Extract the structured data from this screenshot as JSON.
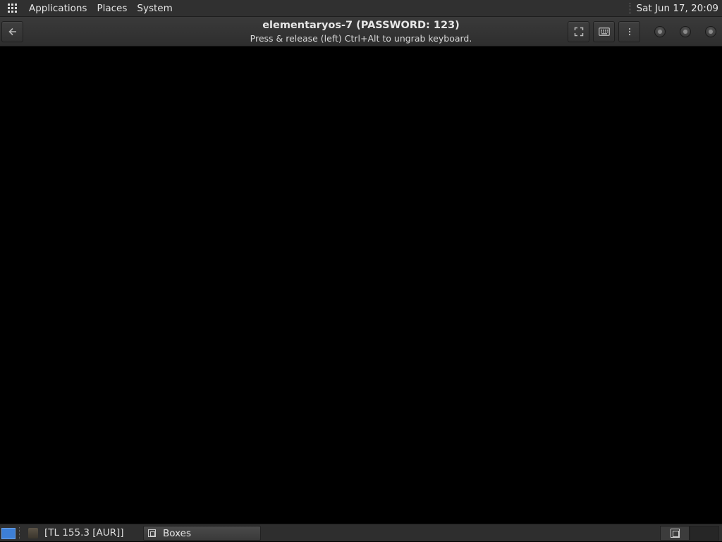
{
  "top_panel": {
    "menus": [
      "Applications",
      "Places",
      "System"
    ],
    "clock": "Sat Jun 17, 20:09"
  },
  "window": {
    "title": "elementaryos-7 (PASSWORD: 123)",
    "subtitle": "Press & release (left) Ctrl+Alt to ungrab keyboard.",
    "icons": {
      "back": "back-arrow-icon",
      "fullscreen": "fullscreen-icon",
      "keyboard": "keyboard-icon",
      "menu": "vertical-dots-icon"
    }
  },
  "bottom_panel": {
    "tray_label": "[TL 155.3 [AUR]]",
    "task": "Boxes",
    "workspaces": 2,
    "active_workspace": 1
  },
  "colors": {
    "panel_bg": "#303030",
    "header_bg": "#353535",
    "display_bg": "#000000",
    "show_desktop": "#3d7fd6"
  }
}
